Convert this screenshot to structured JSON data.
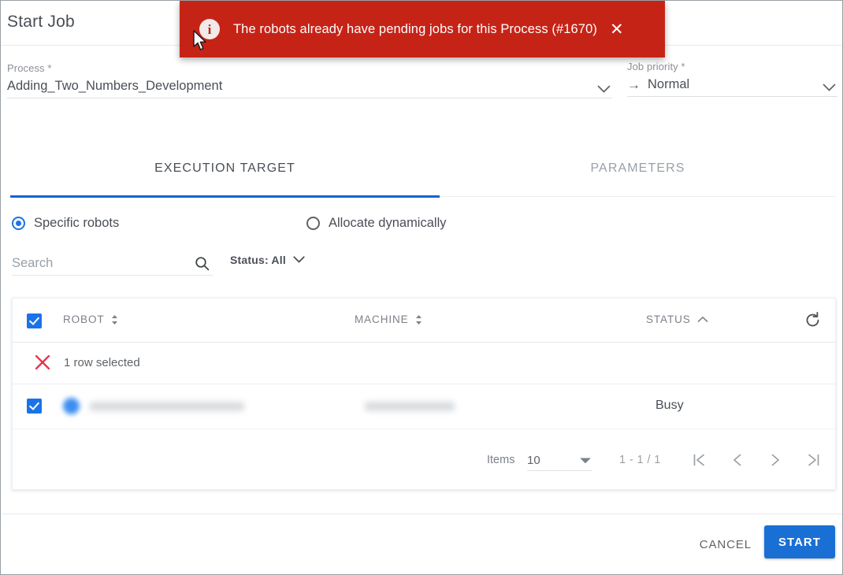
{
  "dialog": {
    "title": "Start Job"
  },
  "toast": {
    "message": "The robots already have pending jobs for this Process (#1670)",
    "close_label": "✕",
    "info_glyph": "i",
    "background_color": "#c62317"
  },
  "form": {
    "process": {
      "label": "Process *",
      "value": "Adding_Two_Numbers_Development"
    },
    "priority": {
      "label": "Job priority *",
      "value": "Normal",
      "arrow_glyph": "→"
    }
  },
  "tabs": [
    {
      "label": "EXECUTION TARGET",
      "active": true
    },
    {
      "label": "PARAMETERS",
      "active": false
    }
  ],
  "target_mode": {
    "options": [
      {
        "label": "Specific robots",
        "selected": true
      },
      {
        "label": "Allocate dynamically",
        "selected": false
      }
    ]
  },
  "search": {
    "placeholder": "Search",
    "value": ""
  },
  "status_filter": {
    "label": "Status: All"
  },
  "table": {
    "columns": [
      {
        "label": "ROBOT",
        "sort": "none"
      },
      {
        "label": "MACHINE",
        "sort": "none"
      },
      {
        "label": "STATUS",
        "sort": "asc"
      }
    ],
    "selection_text": "1 row selected",
    "rows": [
      {
        "selected": true,
        "robot": "",
        "machine": "",
        "status": "Busy"
      }
    ]
  },
  "pagination": {
    "items_label": "Items",
    "items_per_page": "10",
    "range_text": "1 - 1 / 1"
  },
  "footer": {
    "cancel_label": "CANCEL",
    "start_label": "START",
    "accent_color": "#1a6fd4"
  }
}
